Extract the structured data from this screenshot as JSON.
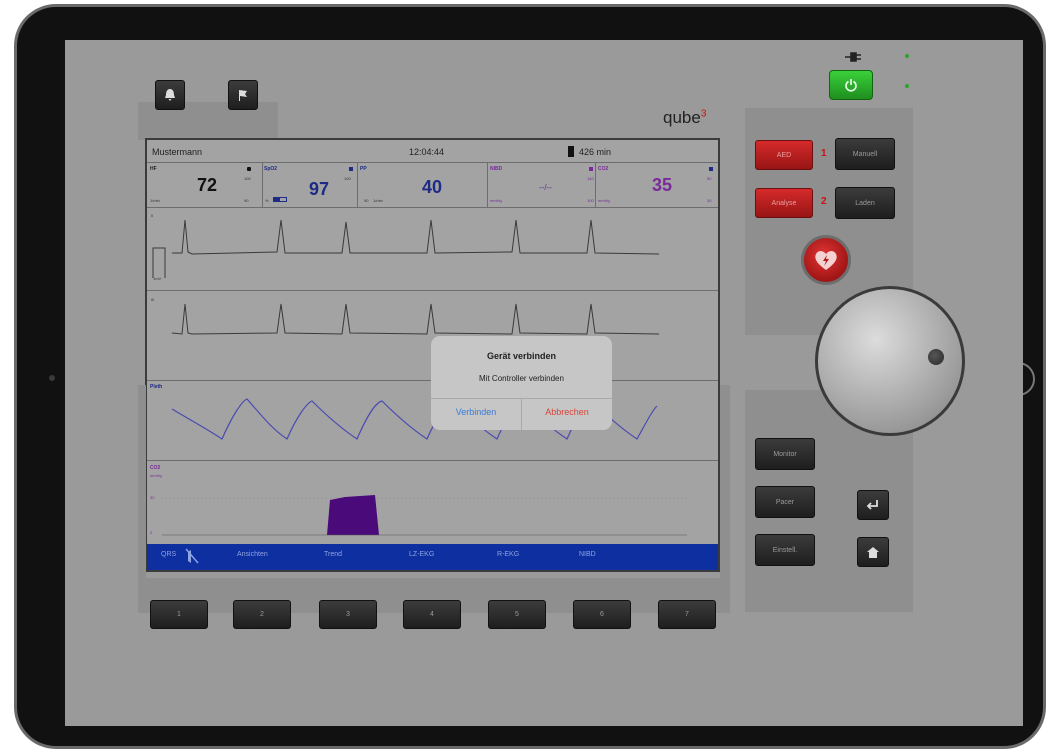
{
  "device": {
    "brand": "qube",
    "brand_sup": "3"
  },
  "monitor": {
    "patient_name": "Mustermann",
    "time": "12:04:44",
    "battery": "426 min"
  },
  "vitals": {
    "hf": {
      "label": "HF",
      "value": "72",
      "unit": "1/min"
    },
    "spo2": {
      "label": "SpO2",
      "value": "97",
      "alarm_high": "100",
      "alarm_low": "90",
      "unit": "%"
    },
    "pp": {
      "label": "PP",
      "value": "40",
      "alarm_high": "100",
      "alarm_low": "50",
      "unit": "1/min"
    },
    "nibd": {
      "label": "NIBD",
      "value": "--/--",
      "alarm_high": "140",
      "alarm_low": "100",
      "unit": "mmHg"
    },
    "co2": {
      "label": "CO2",
      "value": "35",
      "alarm_high": "50",
      "alarm_low": "30",
      "unit": "mmHg"
    }
  },
  "waves": {
    "lead1": "II",
    "scale": "1mV",
    "lead2": "III",
    "pleth": "Pleth",
    "co2": "CO2",
    "co2_unit": "mmHg",
    "co2_mid": "30",
    "co2_low": "0"
  },
  "menu": {
    "qrs": "QRS",
    "items": [
      "Ansichten",
      "Trend",
      "LZ-EKG",
      "R-EKG",
      "NIBD"
    ]
  },
  "right_panel": {
    "aed": "AED",
    "aed_num": "1",
    "manuell": "Manuell",
    "analyse": "Analyse",
    "analyse_num": "2",
    "laden": "Laden",
    "monitor": "Monitor",
    "pacer": "Pacer",
    "einstell": "Einstell."
  },
  "softkeys": [
    "1",
    "2",
    "3",
    "4",
    "5",
    "6",
    "7"
  ],
  "dialog": {
    "title": "Gerät verbinden",
    "message": "Mit Controller verbinden",
    "confirm": "Verbinden",
    "cancel": "Abbrechen",
    "confirm_color": "#3a7bd5",
    "cancel_color": "#d9443c"
  },
  "colors": {
    "wave_line": "#3a3a3a",
    "pleth_line": "#4a4ab0",
    "co2_fill": "#4a0a7a",
    "power_green": "#2aa52a"
  }
}
